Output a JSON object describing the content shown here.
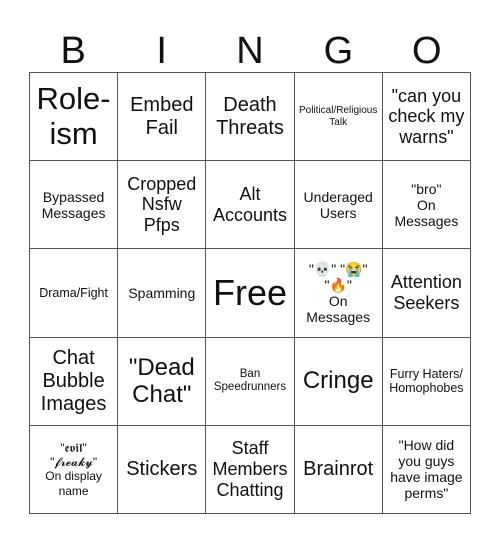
{
  "header": {
    "letters": [
      "B",
      "I",
      "N",
      "G",
      "O"
    ]
  },
  "cells": [
    [
      "Role-\nism",
      "Embed\nFail",
      "Death\nThreats",
      "Political/Religious\nTalk",
      "\"can you\ncheck my\nwarns\""
    ],
    [
      "Bypassed\nMessages",
      "Cropped\nNsfw\nPfps",
      "Alt\nAccounts",
      "Underaged\nUsers",
      "\"bro\"\nOn\nMessages"
    ],
    [
      "Drama/Fight",
      "Spamming",
      "Free",
      "\"💀\" \"😭\"\n\"🔥\"\nOn\nMessages",
      "Attention\nSeekers"
    ],
    [
      "Chat\nBubble\nImages",
      "\"Dead\nChat\"",
      "Ban\nSpeedrunners",
      "Cringe",
      "Furry Haters/\nHomophobes"
    ],
    [
      "\"𝖊𝖛𝖎𝖑\"\n\"𝓯𝓻𝓮𝓪𝓴𝔂\"\nOn display\nname",
      "Stickers",
      "Staff\nMembers\nChatting",
      "Brainrot",
      "\"How did\nyou guys\nhave image\nperms\""
    ]
  ],
  "colors": {
    "border": "#555555",
    "text": "#111111",
    "background": "#ffffff"
  }
}
